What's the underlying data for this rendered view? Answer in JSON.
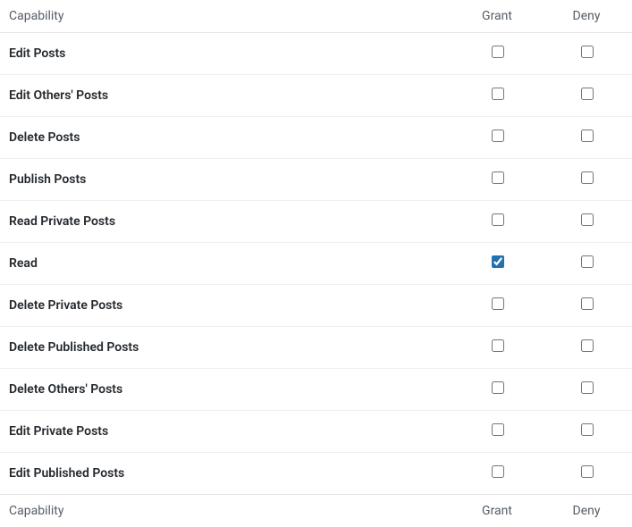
{
  "headers": {
    "capability": "Capability",
    "grant": "Grant",
    "deny": "Deny"
  },
  "rows": [
    {
      "label": "Edit Posts",
      "grant": false,
      "deny": false
    },
    {
      "label": "Edit Others' Posts",
      "grant": false,
      "deny": false
    },
    {
      "label": "Delete Posts",
      "grant": false,
      "deny": false
    },
    {
      "label": "Publish Posts",
      "grant": false,
      "deny": false
    },
    {
      "label": "Read Private Posts",
      "grant": false,
      "deny": false
    },
    {
      "label": "Read",
      "grant": true,
      "deny": false
    },
    {
      "label": "Delete Private Posts",
      "grant": false,
      "deny": false
    },
    {
      "label": "Delete Published Posts",
      "grant": false,
      "deny": false
    },
    {
      "label": "Delete Others' Posts",
      "grant": false,
      "deny": false
    },
    {
      "label": "Edit Private Posts",
      "grant": false,
      "deny": false
    },
    {
      "label": "Edit Published Posts",
      "grant": false,
      "deny": false
    }
  ]
}
